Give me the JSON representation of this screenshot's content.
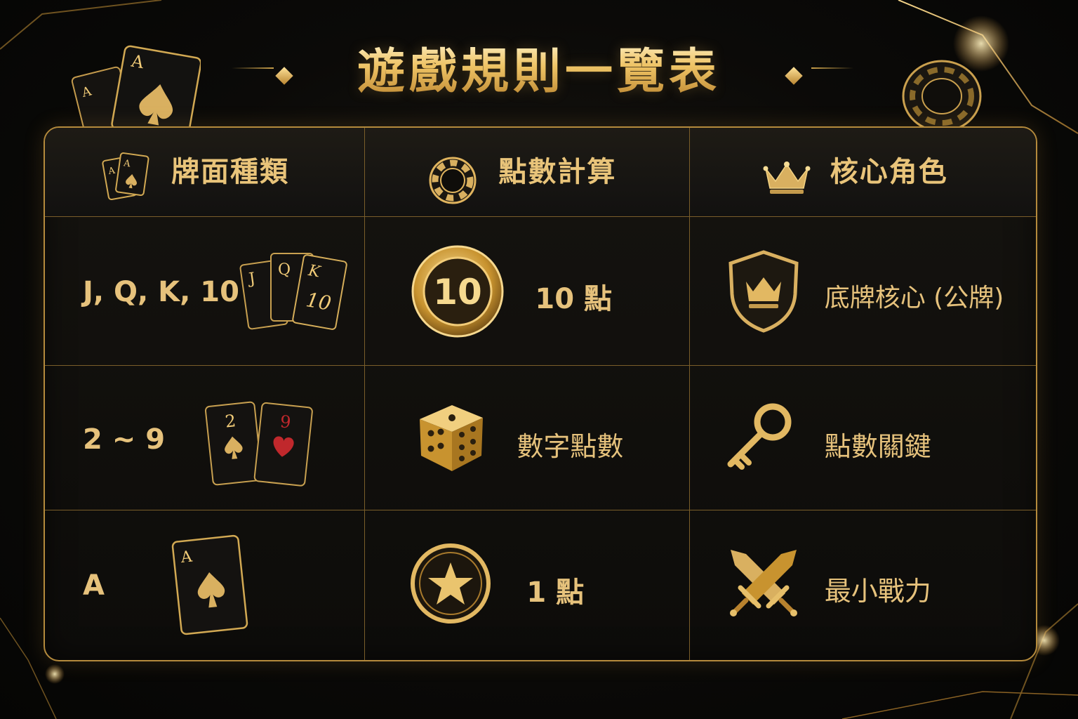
{
  "title": "遊戲規則一覽表",
  "headers": {
    "card_type": "牌面種類",
    "point_calc": "點數計算",
    "core_role": "核心角色"
  },
  "rows": [
    {
      "card": "J, Q, K, 10",
      "points": "10 點",
      "role": "底牌核心 (公牌)",
      "card_icon": "jqk10-cards-icon",
      "point_icon": "chip-10-icon",
      "role_icon": "crown-shield-icon"
    },
    {
      "card": "2 ~ 9",
      "points": "數字點數",
      "role": "點數關鍵",
      "card_icon": "two-nine-cards-icon",
      "point_icon": "dice-icon",
      "role_icon": "key-icon"
    },
    {
      "card": "A",
      "points": "1 點",
      "role": "最小戰力",
      "card_icon": "ace-spade-card-icon",
      "point_icon": "star-coin-icon",
      "role_icon": "crossed-swords-icon"
    }
  ],
  "card_glyphs": {
    "j": "J",
    "q": "Q",
    "k": "K",
    "ten": "10",
    "two": "2",
    "nine": "9",
    "ace": "A",
    "chip_value": "10"
  },
  "colors": {
    "gold": "#e6c27c",
    "gold_bright": "#f5d488",
    "border": "#b48a3c",
    "background": "#0b0a08",
    "heart_red": "#c0282c"
  }
}
